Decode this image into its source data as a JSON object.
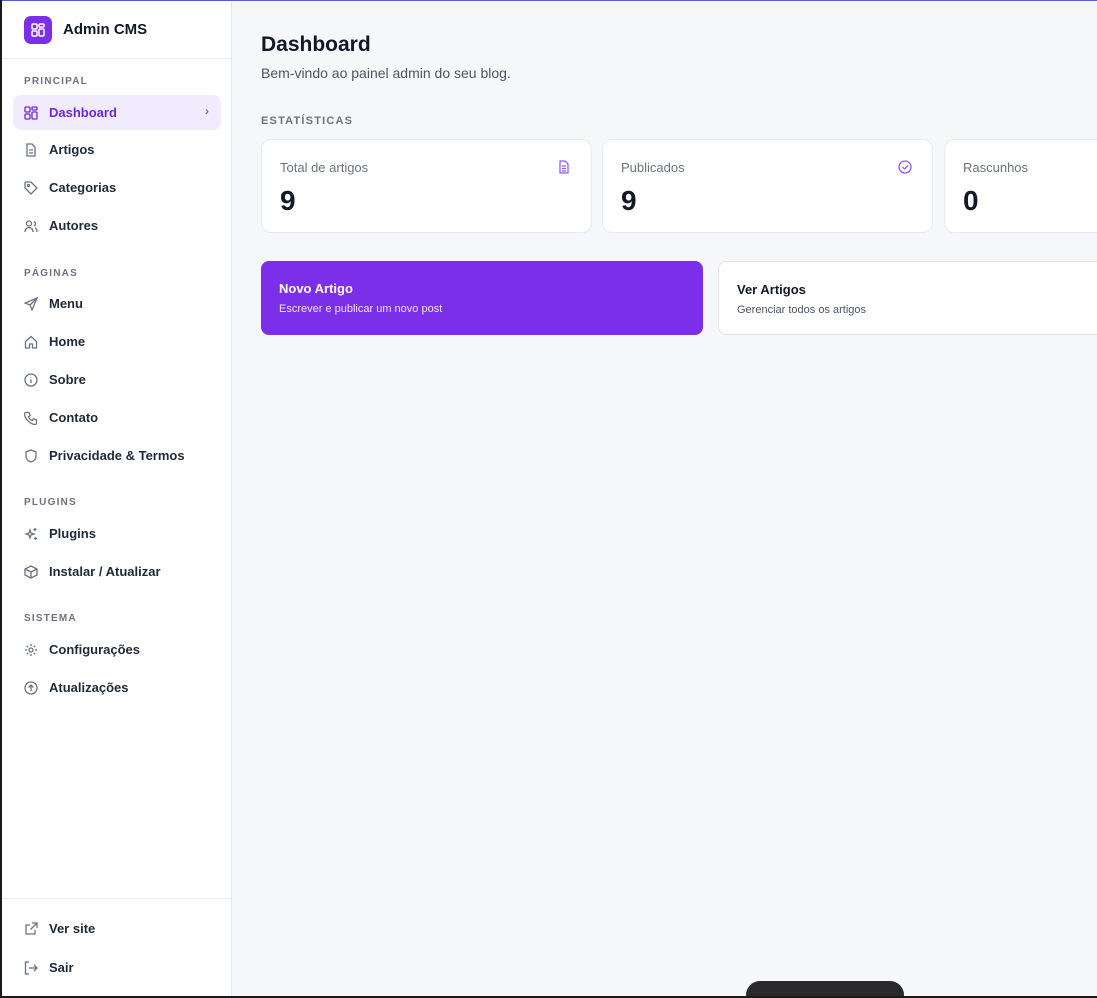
{
  "app": {
    "title": "Admin CMS",
    "logo_icon": "dashboard-grid-icon",
    "accent": "#7c2fe8"
  },
  "sidebar": {
    "sections": [
      {
        "label": "PRINCIPAL"
      },
      {
        "label": "PÁGINAS"
      },
      {
        "label": "PLUGINS"
      },
      {
        "label": "SISTEMA"
      }
    ],
    "items": [
      {
        "label": "Dashboard",
        "icon": "dashboard-grid-icon",
        "active": true
      },
      {
        "label": "Artigos",
        "icon": "document-icon"
      },
      {
        "label": "Categorias",
        "icon": "tag-icon"
      },
      {
        "label": "Autores",
        "icon": "users-icon"
      },
      {
        "label": "Menu",
        "icon": "send-icon"
      },
      {
        "label": "Home",
        "icon": "home-icon"
      },
      {
        "label": "Sobre",
        "icon": "info-icon"
      },
      {
        "label": "Contato",
        "icon": "phone-icon"
      },
      {
        "label": "Privacidade & Termos",
        "icon": "shield-icon"
      },
      {
        "label": "Plugins",
        "icon": "sparkles-icon"
      },
      {
        "label": "Instalar / Atualizar",
        "icon": "package-icon"
      },
      {
        "label": "Configurações",
        "icon": "gear-icon"
      },
      {
        "label": "Atualizações",
        "icon": "arrow-up-circle-icon"
      }
    ],
    "footer": [
      {
        "label": "Ver site",
        "icon": "external-link-icon"
      },
      {
        "label": "Sair",
        "icon": "logout-icon"
      }
    ]
  },
  "main": {
    "title": "Dashboard",
    "subtitle": "Bem-vindo ao painel admin do seu blog.",
    "stats_label": "ESTATÍSTICAS",
    "stats": [
      {
        "label": "Total de artigos",
        "value": "9",
        "icon": "document-icon"
      },
      {
        "label": "Publicados",
        "value": "9",
        "icon": "check-circle-icon"
      },
      {
        "label": "Rascunhos",
        "value": "0",
        "icon": ""
      }
    ],
    "actions": [
      {
        "title": "Novo Artigo",
        "description": "Escrever e publicar um novo post"
      },
      {
        "title": "Ver Artigos",
        "description": "Gerenciar todos os artigos"
      }
    ]
  }
}
